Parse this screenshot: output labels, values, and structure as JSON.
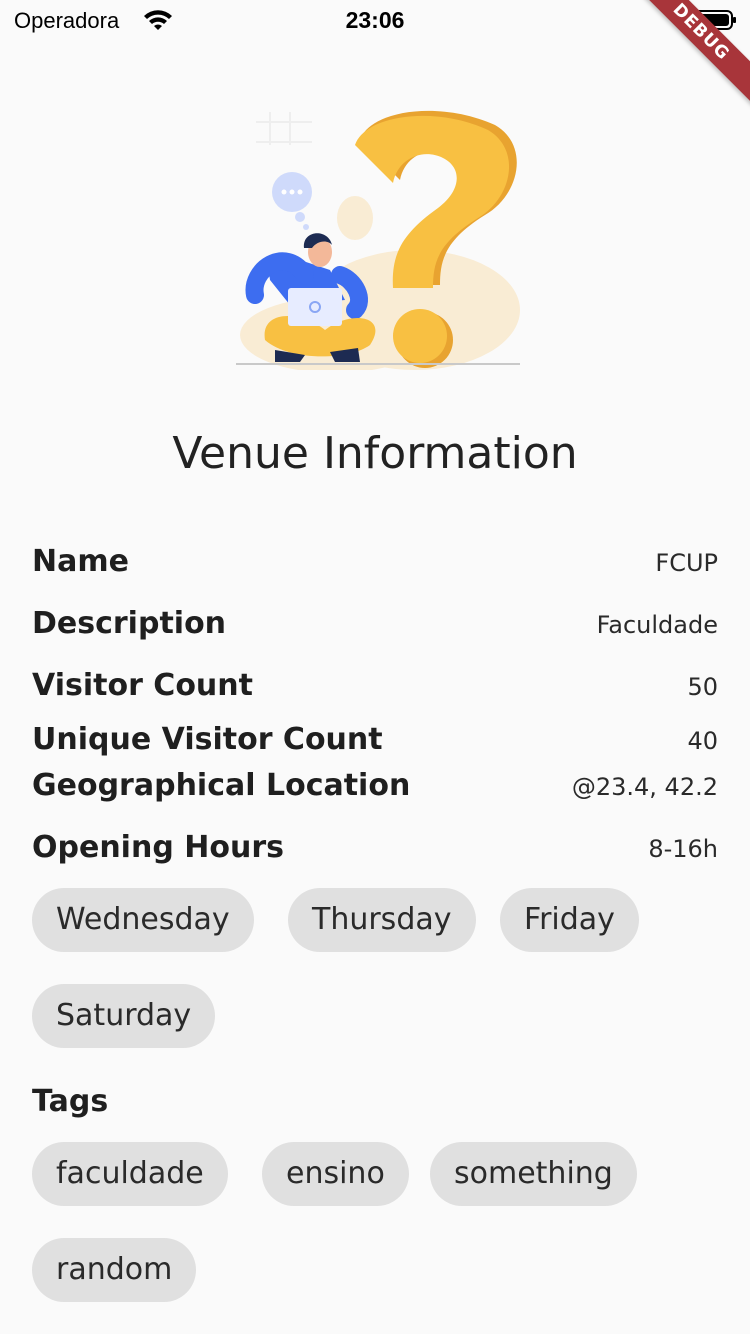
{
  "status_bar": {
    "carrier": "Operadora",
    "time": "23:06"
  },
  "debug_label": "DEBUG",
  "page": {
    "title": "Venue Information"
  },
  "details": [
    {
      "label": "Name",
      "value": "FCUP"
    },
    {
      "label": "Description",
      "value": "Faculdade"
    },
    {
      "label": "Visitor Count",
      "value": "50"
    },
    {
      "label": "Unique Visitor Count",
      "value": "40"
    },
    {
      "label": "Geographical Location",
      "value": "@23.4, 42.2"
    },
    {
      "label": "Opening Hours",
      "value": "8-16h"
    }
  ],
  "days": [
    "Wednesday",
    "Thursday",
    "Friday",
    "Saturday"
  ],
  "tags_title": "Tags",
  "tags": [
    "faculdade",
    "ensino",
    "something",
    "random"
  ],
  "colors": {
    "accent_yellow": "#f8c042",
    "shirt_blue": "#3d6df0",
    "chip_bg": "#e0e0e0",
    "debug_red": "#a8353a"
  }
}
